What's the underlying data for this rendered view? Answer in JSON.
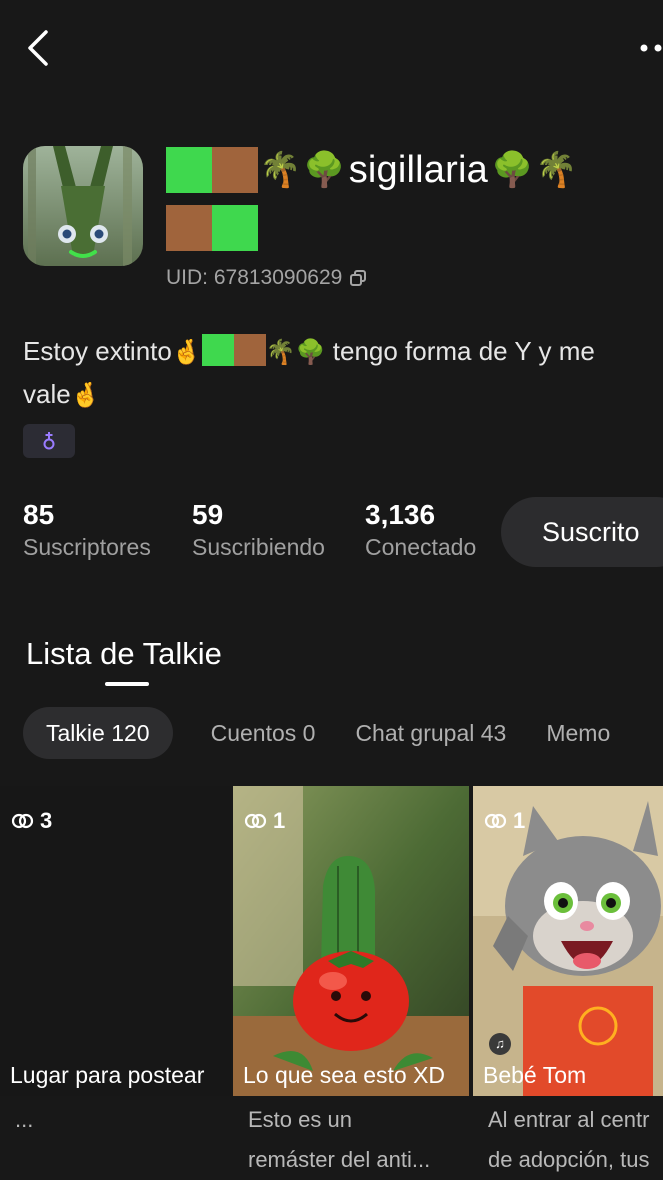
{
  "header": {
    "back_icon": "chevron-left-icon",
    "more_icon": "more-dots-icon"
  },
  "profile": {
    "name": "sigillaria",
    "name_prefix_emojis": [
      "green-square",
      "brown-square",
      "palm-tree",
      "tree"
    ],
    "name_suffix_emojis": [
      "tree",
      "palm-tree"
    ],
    "name_second_line_emojis": [
      "brown-square",
      "green-square"
    ],
    "uid": "UID: 67813090629",
    "bio_part1": "Estoy extinto",
    "bio_part2": " tengo forma de Y y me vale",
    "badge_icon": "gender-symbol-icon"
  },
  "stats": [
    {
      "value": "85",
      "label": "Suscriptores"
    },
    {
      "value": "59",
      "label": "Suscribiendo"
    },
    {
      "value": "3,136",
      "label": "Conectado"
    }
  ],
  "subscribe_button": "Suscrito",
  "section": {
    "title": "Lista de Talkie"
  },
  "tabs": [
    {
      "label": "Talkie 120",
      "active": true
    },
    {
      "label": "Cuentos 0",
      "active": false
    },
    {
      "label": "Chat grupal 43",
      "active": false
    },
    {
      "label": "Memo",
      "active": false
    }
  ],
  "cards": [
    {
      "count": "3",
      "title": "Lugar para postear",
      "desc_line1": "...",
      "desc_line2": ""
    },
    {
      "count": "1",
      "title": "Lo que sea esto XD",
      "desc_line1": "Esto es un",
      "desc_line2": "remáster del anti..."
    },
    {
      "count": "1",
      "title": "Bebé Tom",
      "desc_line1": "Al entrar al centr",
      "desc_line2": "de adopción, tus"
    }
  ],
  "colors": {
    "background": "#181818",
    "green_square": "#3fd84e",
    "brown_square": "#a0643c",
    "badge_purple": "#9a7cff"
  }
}
